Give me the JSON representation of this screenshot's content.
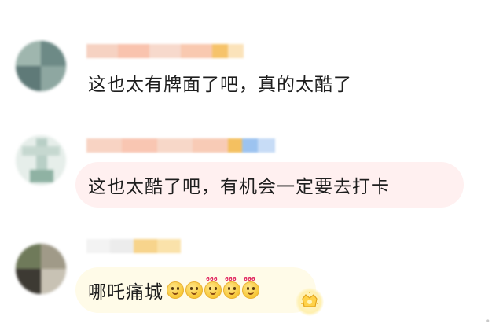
{
  "comments": [
    {
      "text": "这也太有牌面了吧，真的太酷了",
      "emojis": []
    },
    {
      "text": "这也太酷了吧，有机会一定要去打卡",
      "emojis": []
    },
    {
      "text": "哪吒痛城",
      "emojis": [
        {
          "icon": "laughing-face-emoji",
          "tag": ""
        },
        {
          "icon": "flower-face-emoji",
          "tag": ""
        },
        {
          "icon": "666-face-emoji",
          "tag": "666"
        },
        {
          "icon": "666-face-emoji",
          "tag": "666"
        },
        {
          "icon": "666-face-emoji",
          "tag": "666"
        }
      ],
      "badge_icon": "crown-star-badge-icon"
    }
  ],
  "colors": {
    "bubble_1": "#ffffff",
    "bubble_2": "#fff0f0",
    "bubble_3": "#fffbe8",
    "text": "#1e1e1e",
    "name_blur_peach": "#f9c9b0",
    "name_blur_gold": "#f6c36a"
  }
}
